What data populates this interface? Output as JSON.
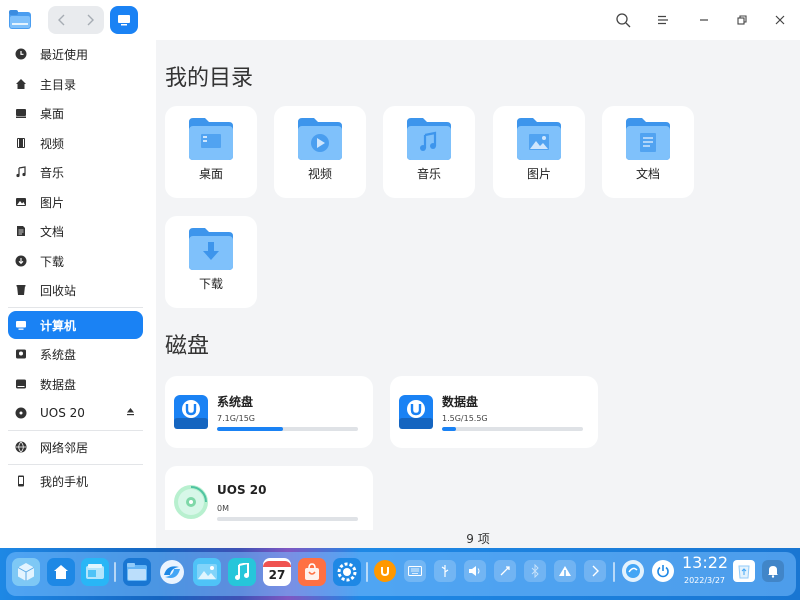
{
  "titlebar": {
    "back_icon": "chevron-left-icon",
    "forward_icon": "chevron-right-icon",
    "view_icon": "computer-view-icon",
    "search_icon": "search-icon",
    "menu_icon": "menu-icon",
    "minimize_icon": "minimize-icon",
    "restore_icon": "restore-icon",
    "close_icon": "close-icon"
  },
  "sidebar": {
    "items": [
      {
        "label": "最近使用",
        "icon": "clock-icon"
      },
      {
        "label": "主目录",
        "icon": "home-icon"
      },
      {
        "label": "桌面",
        "icon": "desktop-icon"
      },
      {
        "label": "视频",
        "icon": "video-icon"
      },
      {
        "label": "音乐",
        "icon": "music-icon"
      },
      {
        "label": "图片",
        "icon": "picture-icon"
      },
      {
        "label": "文档",
        "icon": "document-icon"
      },
      {
        "label": "下载",
        "icon": "download-icon"
      },
      {
        "label": "回收站",
        "icon": "trash-icon"
      },
      {
        "label": "计算机",
        "icon": "computer-icon",
        "active": true
      },
      {
        "label": "系统盘",
        "icon": "disk-icon"
      },
      {
        "label": "数据盘",
        "icon": "disk-icon"
      },
      {
        "label": "UOS 20",
        "icon": "optical-disc-icon",
        "eject_icon": "eject-icon"
      },
      {
        "label": "网络邻居",
        "icon": "network-icon"
      },
      {
        "label": "我的手机",
        "icon": "phone-icon"
      }
    ]
  },
  "main": {
    "my_dirs_title": "我的目录",
    "dirs": [
      {
        "label": "桌面",
        "icon": "desktop-folder-icon"
      },
      {
        "label": "视频",
        "icon": "video-folder-icon"
      },
      {
        "label": "音乐",
        "icon": "music-folder-icon"
      },
      {
        "label": "图片",
        "icon": "picture-folder-icon"
      },
      {
        "label": "文档",
        "icon": "document-folder-icon"
      },
      {
        "label": "下载",
        "icon": "download-folder-icon"
      }
    ],
    "disks_title": "磁盘",
    "disks": [
      {
        "name": "系统盘",
        "size": "7.1G/15G",
        "usage_fraction": 0.47
      },
      {
        "name": "数据盘",
        "size": "1.5G/15.5G",
        "usage_fraction": 0.1
      },
      {
        "name": "UOS 20",
        "size": "0M",
        "usage_fraction": 0
      }
    ],
    "item_count": "9 项"
  },
  "dock": {
    "time": "13:22",
    "date": "2022/3/27",
    "calendar_day": "27",
    "accent": "#1a82f4"
  }
}
